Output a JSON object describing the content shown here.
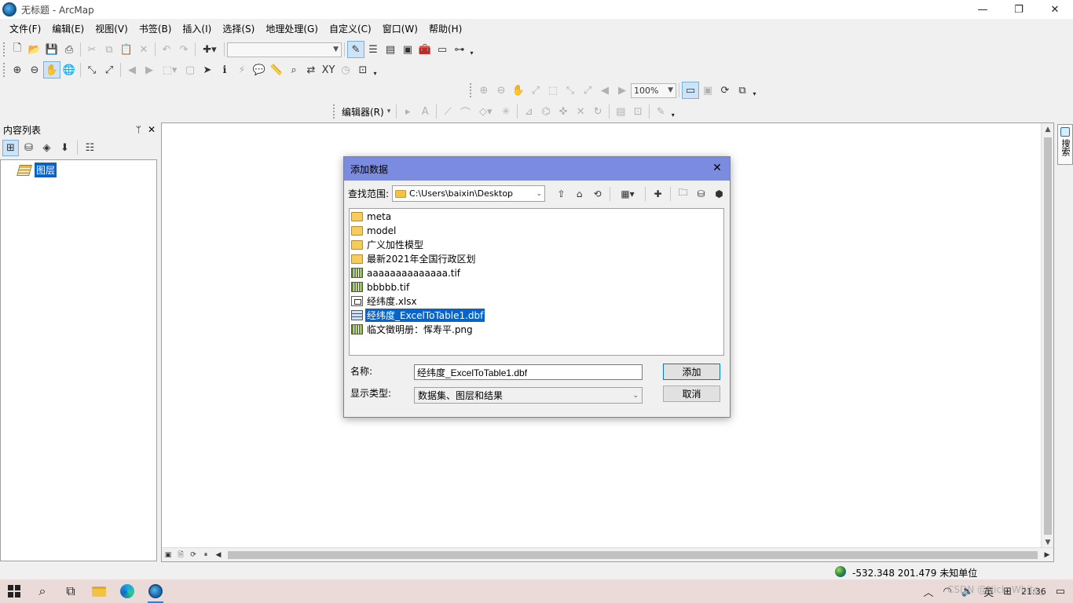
{
  "window": {
    "title": "无标题 - ArcMap",
    "minimize": "—",
    "restore": "❐",
    "close": "✕"
  },
  "menu": [
    "文件(F)",
    "编辑(E)",
    "视图(V)",
    "书签(B)",
    "插入(I)",
    "选择(S)",
    "地理处理(G)",
    "自定义(C)",
    "窗口(W)",
    "帮助(H)"
  ],
  "toolbars": {
    "scale_value": "",
    "zoom_percent": "100%",
    "editor_label": "编辑器(R)"
  },
  "toc": {
    "title": "内容列表",
    "pin": "ᛘ",
    "close": "✕",
    "layer_name": "图层"
  },
  "side_tab": {
    "label": "搜索"
  },
  "status": {
    "coordinates": "-532.348  201.479 未知单位"
  },
  "dialog": {
    "title": "添加数据",
    "close": "✕",
    "look_in_label": "查找范围:",
    "look_in_path": "C:\\Users\\baixin\\Desktop",
    "files": [
      {
        "name": "meta",
        "type": "folder"
      },
      {
        "name": "model",
        "type": "folder"
      },
      {
        "name": "广义加性模型",
        "type": "folder"
      },
      {
        "name": "最新2021年全国行政区划",
        "type": "folder"
      },
      {
        "name": "aaaaaaaaaaaaaa.tif",
        "type": "raster"
      },
      {
        "name": "bbbbb.tif",
        "type": "raster"
      },
      {
        "name": "经纬度.xlsx",
        "type": "xlsx"
      },
      {
        "name": "经纬度_ExcelToTable1.dbf",
        "type": "table",
        "selected": true
      },
      {
        "name": "临文徵明册：恽寿平.png",
        "type": "raster"
      }
    ],
    "name_label": "名称:",
    "name_value": "经纬度_ExcelToTable1.dbf",
    "type_label": "显示类型:",
    "type_value": "数据集、图层和结果",
    "add_button": "添加",
    "cancel_button": "取消"
  },
  "taskbar": {
    "clock": "21:36",
    "ime": "英",
    "watermark": "CSDN @Nick_White_"
  }
}
